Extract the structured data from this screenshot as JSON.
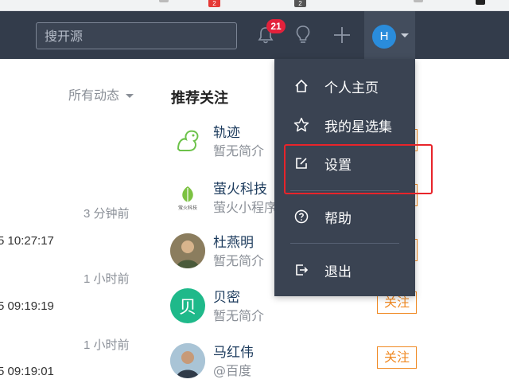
{
  "browser": {
    "extension_badges": [
      "2",
      "2"
    ]
  },
  "header": {
    "search_placeholder": "搜开源",
    "notification_count": "21",
    "user_initial": "H"
  },
  "feed": {
    "filter_label": "所有动态",
    "times": [
      "3 分钟前",
      "1 小时前",
      "1 小时前"
    ],
    "timestamps": [
      "5 10:27:17",
      "5 09:19:19",
      "5 09:19:01"
    ]
  },
  "recommend": {
    "title": "推荐关注",
    "users": [
      {
        "name": "轨迹",
        "desc": "暂无简介",
        "follow": ""
      },
      {
        "name": "萤火科技",
        "desc": "萤火小程序",
        "follow": "",
        "logo_text": "萤火科技"
      },
      {
        "name": "杜燕明",
        "desc": "暂无简介",
        "follow": ""
      },
      {
        "name": "贝密",
        "desc": "暂无简介",
        "follow": "关注",
        "avatar_char": "贝"
      },
      {
        "name": "马红伟",
        "desc": "@百度",
        "follow": "关注"
      }
    ]
  },
  "user_menu": {
    "items": [
      {
        "label": "个人主页",
        "icon": "home-icon"
      },
      {
        "label": "我的星选集",
        "icon": "star-icon"
      },
      {
        "label": "设置",
        "icon": "edit-icon"
      },
      {
        "label": "帮助",
        "icon": "help-icon"
      },
      {
        "label": "退出",
        "icon": "logout-icon"
      }
    ]
  },
  "colors": {
    "header_bg": "#333c4b",
    "menu_bg": "#3a4352",
    "accent_orange": "#f08a24",
    "badge_red": "#e3213b",
    "highlight_red": "#e8242a",
    "avatar_blue": "#2a8cdb",
    "beimi_green": "#1fb98a"
  }
}
